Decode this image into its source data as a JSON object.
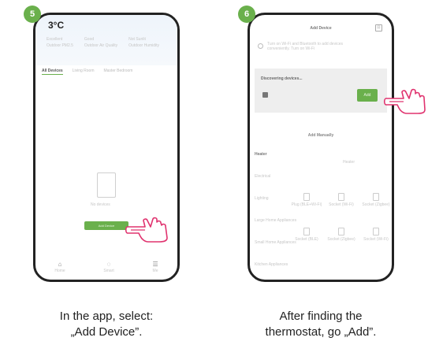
{
  "steps": [
    {
      "number": "5",
      "caption_line1": "In the app, select:",
      "caption_line2": "„Add Device”.",
      "screen": {
        "temperature": "3°C",
        "stats": [
          {
            "label": "Excellent",
            "sub": "Outdoor PM2.5"
          },
          {
            "label": "Good",
            "sub": "Outdoor Air Quality"
          },
          {
            "label": "Not Sunlit",
            "sub": "Outdoor Humidity"
          }
        ],
        "tabs": [
          "All Devices",
          "Living Room",
          "Master Bedroom"
        ],
        "empty_text": "No devices",
        "add_button": "Add Device",
        "nav": [
          {
            "label": "Home",
            "icon": "home-icon"
          },
          {
            "label": "Smart",
            "icon": "smart-icon"
          },
          {
            "label": "Me",
            "icon": "profile-icon"
          }
        ]
      }
    },
    {
      "number": "6",
      "caption_line1": "After finding the",
      "caption_line2": "thermostat, go „Add”.",
      "screen": {
        "title": "Add Device",
        "notice_line1": "Turn on Wi-Fi and Bluetooth to add devices",
        "notice_line2": "conveniently. Turn on Wi-Fi",
        "scan_label": "Discovering devices...",
        "add_button": "Add",
        "manual_title": "Add Manually",
        "category_head": "Heater",
        "column_head": "Heater",
        "side_categories": [
          "Electrical",
          "Lighting",
          "Large Home Appliances",
          "Small Home Appliances",
          "Kitchen Appliances"
        ],
        "devices": [
          {
            "label": "Plug (BLE+Wi-Fi)"
          },
          {
            "label": "Socket (Wi-Fi)"
          },
          {
            "label": "Socket (Zigbee)"
          },
          {
            "label": "Socket (BLE)"
          },
          {
            "label": "Socket (Zigbee)"
          },
          {
            "label": "Socket (Wi-Fi)"
          }
        ]
      }
    }
  ],
  "colors": {
    "accent": "#6ab04c",
    "frame": "#222222"
  }
}
